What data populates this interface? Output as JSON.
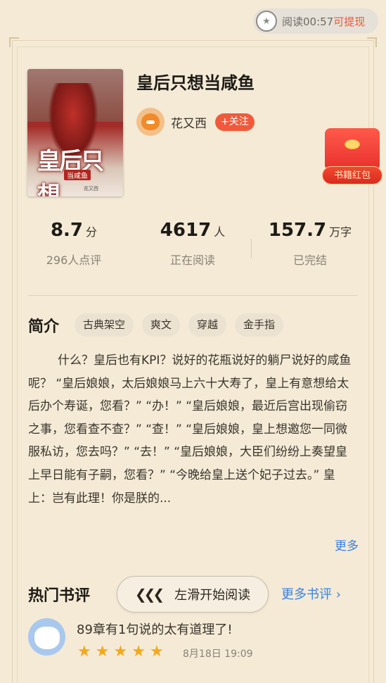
{
  "timer": {
    "label": "阅读00:57",
    "action": "可提现",
    "icon": "star-coin-icon"
  },
  "book": {
    "title": "皇后只想当咸鱼",
    "cover_title": "皇后只想",
    "cover_sub": "当咸鱼",
    "cover_author": "花又西"
  },
  "author": {
    "name": "花又西",
    "follow_label": "+关注"
  },
  "red_packet": {
    "label": "书籍红包"
  },
  "stats": [
    {
      "value": "8.7",
      "unit": "分",
      "caption": "296人点评"
    },
    {
      "value": "4617",
      "unit": "人",
      "caption": "正在阅读"
    },
    {
      "value": "157.7",
      "unit": "万字",
      "caption": "已完结"
    }
  ],
  "intro": {
    "heading": "简介",
    "tags": [
      "古典架空",
      "爽文",
      "穿越",
      "金手指"
    ],
    "text": "什么？皇后也有KPI？说好的花瓶说好的躺尸说好的咸鱼呢？ “皇后娘娘，太后娘娘马上六十大寿了，皇上有意想给太后办个寿诞，您看？” “办！” “皇后娘娘，最近后宫出现偷窃之事，您看查不查？” “查！” “皇后娘娘，皇上想邀您一同微服私访，您去吗？” “去！” “皇后娘娘，大臣们纷纷上奏望皇上早日能有子嗣，您看？” “今晚给皇上送个妃子过去。” 皇上：岂有此理！你是朕的...",
    "more_label": "更多"
  },
  "reviews": {
    "heading": "热门书评",
    "swipe_label": "左滑开始阅读",
    "more_label": "更多书评",
    "items": [
      {
        "text": "89章有1句说的太有道理了!",
        "stars": 5,
        "date": "8月18日 19:09"
      }
    ]
  },
  "colors": {
    "background": "#f4ead6",
    "accent_red": "#f05a3c",
    "link_blue": "#3a82e2",
    "star": "#f3a81e"
  }
}
